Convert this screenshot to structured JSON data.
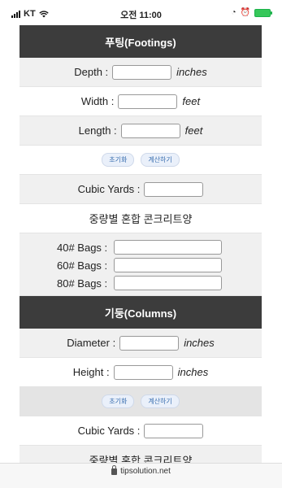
{
  "status_bar": {
    "carrier": "KT",
    "time": "오전 11:00"
  },
  "footings": {
    "title": "푸팅(Footings)",
    "depth_label": "Depth :",
    "depth_unit": "inches",
    "width_label": "Width :",
    "width_unit": "feet",
    "length_label": "Length :",
    "length_unit": "feet",
    "reset_label": "초기화",
    "calc_label": "계산하기",
    "cubic_yards_label": "Cubic Yards :",
    "by_weight_label": "중량별 혼합 콘크리트양",
    "bag40_label": "40# Bags :",
    "bag60_label": "60# Bags :",
    "bag80_label": "80# Bags :"
  },
  "columns": {
    "title": "기둥(Columns)",
    "diameter_label": "Diameter :",
    "diameter_unit": "inches",
    "height_label": "Height :",
    "height_unit": "inches",
    "reset_label": "초기화",
    "calc_label": "계산하기",
    "cubic_yards_label": "Cubic Yards :",
    "by_weight_label": "중량별 혼합 콘크리트양"
  },
  "url_bar": {
    "url": "tipsolution.net"
  },
  "colors": {
    "header_bg": "#3c3c3c",
    "battery": "#36c75a"
  }
}
